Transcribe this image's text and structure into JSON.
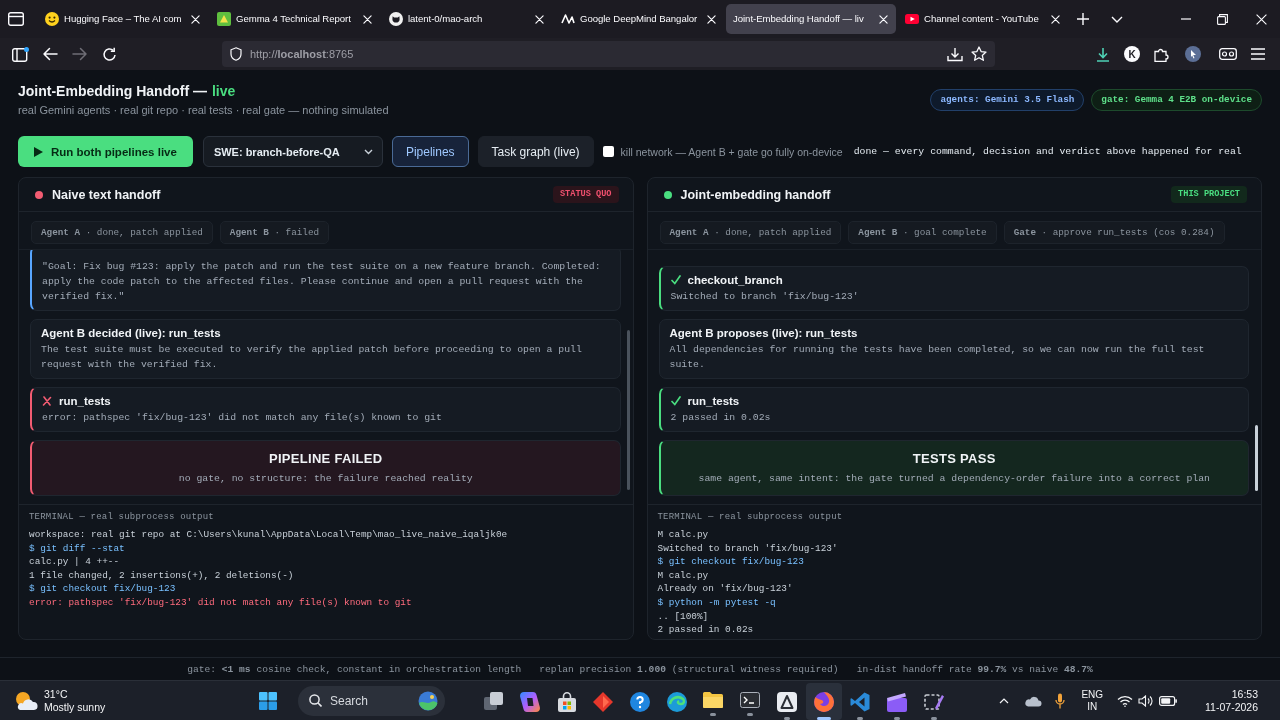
{
  "browser": {
    "tabs": [
      {
        "title": "Hugging Face – The AI com",
        "selected": false
      },
      {
        "title": "Gemma 4 Technical Report",
        "selected": false
      },
      {
        "title": "latent-0/mao-arch",
        "selected": false
      },
      {
        "title": "Google DeepMind Bangalor",
        "selected": false
      },
      {
        "title": "Joint-Embedding Handoff — liv",
        "selected": true
      },
      {
        "title": "Channel content - YouTube",
        "selected": false
      }
    ],
    "url": "http://**localhost**:8765",
    "profile_initial": "K"
  },
  "header": {
    "title": "Joint-Embedding Handoff —",
    "live_label": "live",
    "subtitle": "real Gemini agents · real git repo · real tests · real gate — nothing simulated",
    "badges": [
      {
        "kind": "agents",
        "label": "agents: Gemini 3.5 Flash"
      },
      {
        "kind": "gate",
        "label": "gate: Gemma 4 E2B on-device"
      }
    ]
  },
  "toolbar": {
    "run_button": "Run both pipelines live",
    "scenario": "SWE: branch-before-QA",
    "views": [
      {
        "label": "Pipelines",
        "selected": true
      },
      {
        "label": "Task graph (live)",
        "selected": false
      }
    ],
    "kill_network": {
      "label": "kill network — Agent B + gate go fully on-device",
      "checked": false
    },
    "status": "done — every command, decision and verdict above happened for real"
  },
  "pipelines": [
    {
      "kind": "fail",
      "title": "Naive text handoff",
      "badge": "STATUS QUO",
      "agents": [
        "**Agent A** · done, patch applied",
        "**Agent B** · failed"
      ],
      "cards": [
        {
          "kind": "quote",
          "text": "\"Goal: Fix bug #123: apply the patch and run the test suite on a new feature branch. Completed: apply the code patch to the affected files. Please continue and open a pull request with the verified fix.\""
        },
        {
          "kind": "decision",
          "title": "Agent B decided (live): run_tests",
          "text": "The test suite must be executed to verify the applied patch before proceeding to open a pull request with the verified fix."
        },
        {
          "kind": "step",
          "passed": false,
          "title": "run_tests",
          "text": "error: pathspec 'fix/bug-123' did not match any file(s) known to git"
        },
        {
          "kind": "verdict",
          "passed": false,
          "title": "PIPELINE FAILED",
          "text": "no gate, no structure: the failure reached reality"
        }
      ],
      "terminal": {
        "title": "TERMINAL — real subprocess output",
        "lines": [
          {
            "kind": "out",
            "text": "workspace: real git repo at C:\\Users\\kunal\\AppData\\Local\\Temp\\mao_live_naive_iqaljk0e"
          },
          {
            "kind": "cmd",
            "text": "$ git diff --stat"
          },
          {
            "kind": "out",
            "text": "calc.py | 4 ++--"
          },
          {
            "kind": "out",
            "text": "1 file changed, 2 insertions(+), 2 deletions(-)"
          },
          {
            "kind": "cmd",
            "text": "$ git checkout fix/bug-123"
          },
          {
            "kind": "err",
            "text": "error: pathspec 'fix/bug-123' did not match any file(s) known to git"
          }
        ]
      }
    },
    {
      "kind": "pass",
      "title": "Joint-embedding handoff",
      "badge": "THIS PROJECT",
      "agents": [
        "**Agent A** · done, patch applied",
        "**Agent B** · goal complete",
        "**Gate** · approve run_tests (cos 0.284)"
      ],
      "cards": [
        {
          "kind": "step",
          "passed": true,
          "title": "checkout_branch",
          "text": "Switched to branch 'fix/bug-123'"
        },
        {
          "kind": "decision",
          "title": "Agent B proposes (live): run_tests",
          "text": "All dependencies for running the tests have been completed, so we can now run the full test suite."
        },
        {
          "kind": "step",
          "passed": true,
          "title": "run_tests",
          "text": "2 passed in 0.02s"
        },
        {
          "kind": "verdict",
          "passed": true,
          "title": "TESTS PASS",
          "text": "same agent, same intent: the gate turned a dependency-order failure into a correct plan"
        }
      ],
      "terminal": {
        "title": "TERMINAL — real subprocess output",
        "lines": [
          {
            "kind": "out",
            "text": "M calc.py"
          },
          {
            "kind": "out",
            "text": "Switched to branch 'fix/bug-123'"
          },
          {
            "kind": "cmd",
            "text": "$ git checkout fix/bug-123"
          },
          {
            "kind": "out",
            "text": "M calc.py"
          },
          {
            "kind": "out",
            "text": "Already on 'fix/bug-123'"
          },
          {
            "kind": "cmd",
            "text": "$ python -m pytest -q"
          },
          {
            "kind": "out",
            "text": ".. [100%]"
          },
          {
            "kind": "out",
            "text": "2 passed in 0.02s"
          }
        ]
      }
    }
  ],
  "footer": {
    "metrics": [
      "gate: **<1 ms** cosine check, constant in orchestration length",
      "replan precision **1.000** (structural witness required)",
      "in-dist handoff rate **99.7%** vs naive **48.7%**"
    ]
  },
  "taskbar": {
    "weather": {
      "temperature": "31°C",
      "condition": "Mostly sunny"
    },
    "search": {
      "placeholder": "Search"
    },
    "apps": [
      {
        "running": false,
        "selected": false
      },
      {
        "running": false,
        "selected": false
      },
      {
        "running": false,
        "selected": false
      },
      {
        "running": false,
        "selected": false
      },
      {
        "running": false,
        "selected": false
      },
      {
        "running": false,
        "selected": false
      },
      {
        "running": true,
        "selected": false
      },
      {
        "running": true,
        "selected": false
      },
      {
        "running": true,
        "selected": false
      },
      {
        "running": true,
        "selected": true
      },
      {
        "running": true,
        "selected": false
      },
      {
        "running": true,
        "selected": false
      },
      {
        "running": true,
        "selected": false
      }
    ],
    "language": [
      "ENG",
      "IN"
    ],
    "clock": {
      "time": "16:53",
      "date": "11-07-2026"
    }
  }
}
